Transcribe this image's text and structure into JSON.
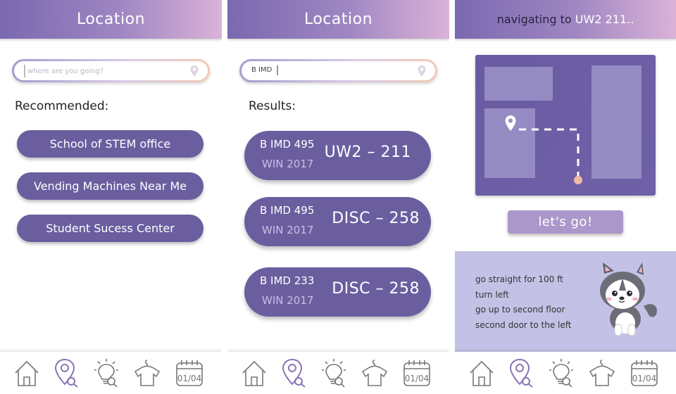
{
  "screen1": {
    "title": "Location",
    "search_placeholder": "where are you going?",
    "section_label": "Recommended:",
    "recommendations": [
      "School of STEM office",
      "Vending Machines Near Me",
      "Student Sucess Center"
    ]
  },
  "screen2": {
    "title": "Location",
    "search_value": "B IMD",
    "section_label": "Results:",
    "results": [
      {
        "course": "B IMD 495",
        "term": "WIN 2017",
        "room": "UW2 – 211"
      },
      {
        "course": "B IMD 495",
        "term": "WIN 2017",
        "room": "DISC – 258"
      },
      {
        "course": "B IMD 233",
        "term": "WIN 2017",
        "room": "DISC – 258"
      }
    ]
  },
  "screen3": {
    "header_prefix": "navigating to",
    "header_dest": "UW2 211..",
    "go_label": "let's go!",
    "directions": [
      "go straight for 100 ft",
      "turn left",
      "go up to second floor",
      "second door to the left"
    ]
  },
  "nav": {
    "icons": [
      "home-icon",
      "location-search-icon",
      "idea-search-icon",
      "clothing-icon",
      "calendar-icon"
    ],
    "calendar_text": "01/04",
    "active_color": "#8a74b8"
  },
  "colors": {
    "accent": "#6b5e9f",
    "button_light": "#ab97c9",
    "panel": "#c3c2e6",
    "route_end": "#f3b8a8"
  }
}
